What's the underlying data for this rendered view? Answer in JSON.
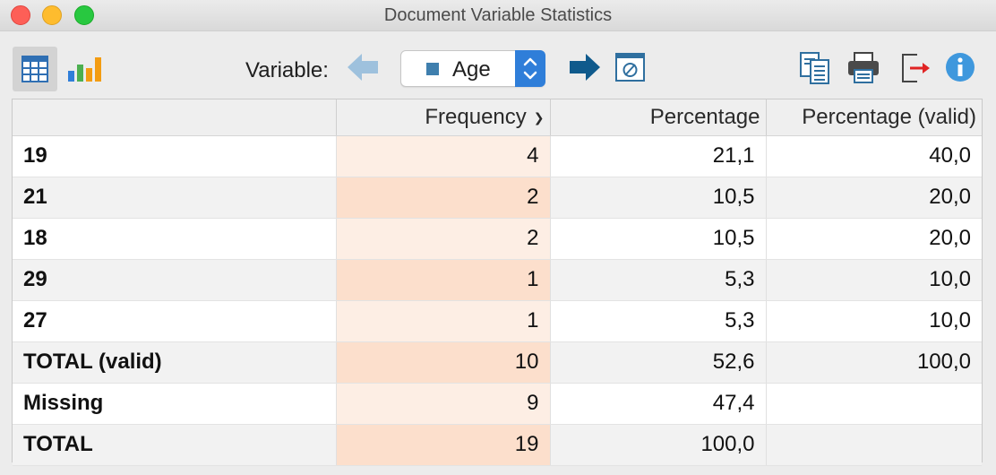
{
  "window": {
    "title": "Document Variable Statistics"
  },
  "toolbar": {
    "variable_label": "Variable:",
    "selected_variable": "Age",
    "icons": {
      "table_view": "table-icon",
      "chart_view": "bar-chart-icon",
      "previous": "arrow-left-icon",
      "next": "arrow-right-icon",
      "filter": "filter-icon",
      "copy": "copy-icon",
      "print": "printer-icon",
      "export": "export-icon",
      "info": "info-icon"
    }
  },
  "table": {
    "headers": [
      "",
      "Frequency",
      "Percentage",
      "Percentage (valid)"
    ],
    "rows": [
      {
        "label": "19",
        "frequency": "4",
        "percentage": "21,1",
        "valid": "40,0"
      },
      {
        "label": "21",
        "frequency": "2",
        "percentage": "10,5",
        "valid": "20,0"
      },
      {
        "label": "18",
        "frequency": "2",
        "percentage": "10,5",
        "valid": "20,0"
      },
      {
        "label": "29",
        "frequency": "1",
        "percentage": "5,3",
        "valid": "10,0"
      },
      {
        "label": "27",
        "frequency": "1",
        "percentage": "5,3",
        "valid": "10,0"
      },
      {
        "label": "TOTAL (valid)",
        "frequency": "10",
        "percentage": "52,6",
        "valid": "100,0"
      },
      {
        "label": "Missing",
        "frequency": "9",
        "percentage": "47,4",
        "valid": ""
      },
      {
        "label": "TOTAL",
        "frequency": "19",
        "percentage": "100,0",
        "valid": ""
      }
    ]
  },
  "colors": {
    "accent": "#2f7ed9",
    "arrow_active": "#0f5a8c",
    "arrow_inactive": "#9ec1dd",
    "freq_highlight": "#fcdfcc"
  }
}
